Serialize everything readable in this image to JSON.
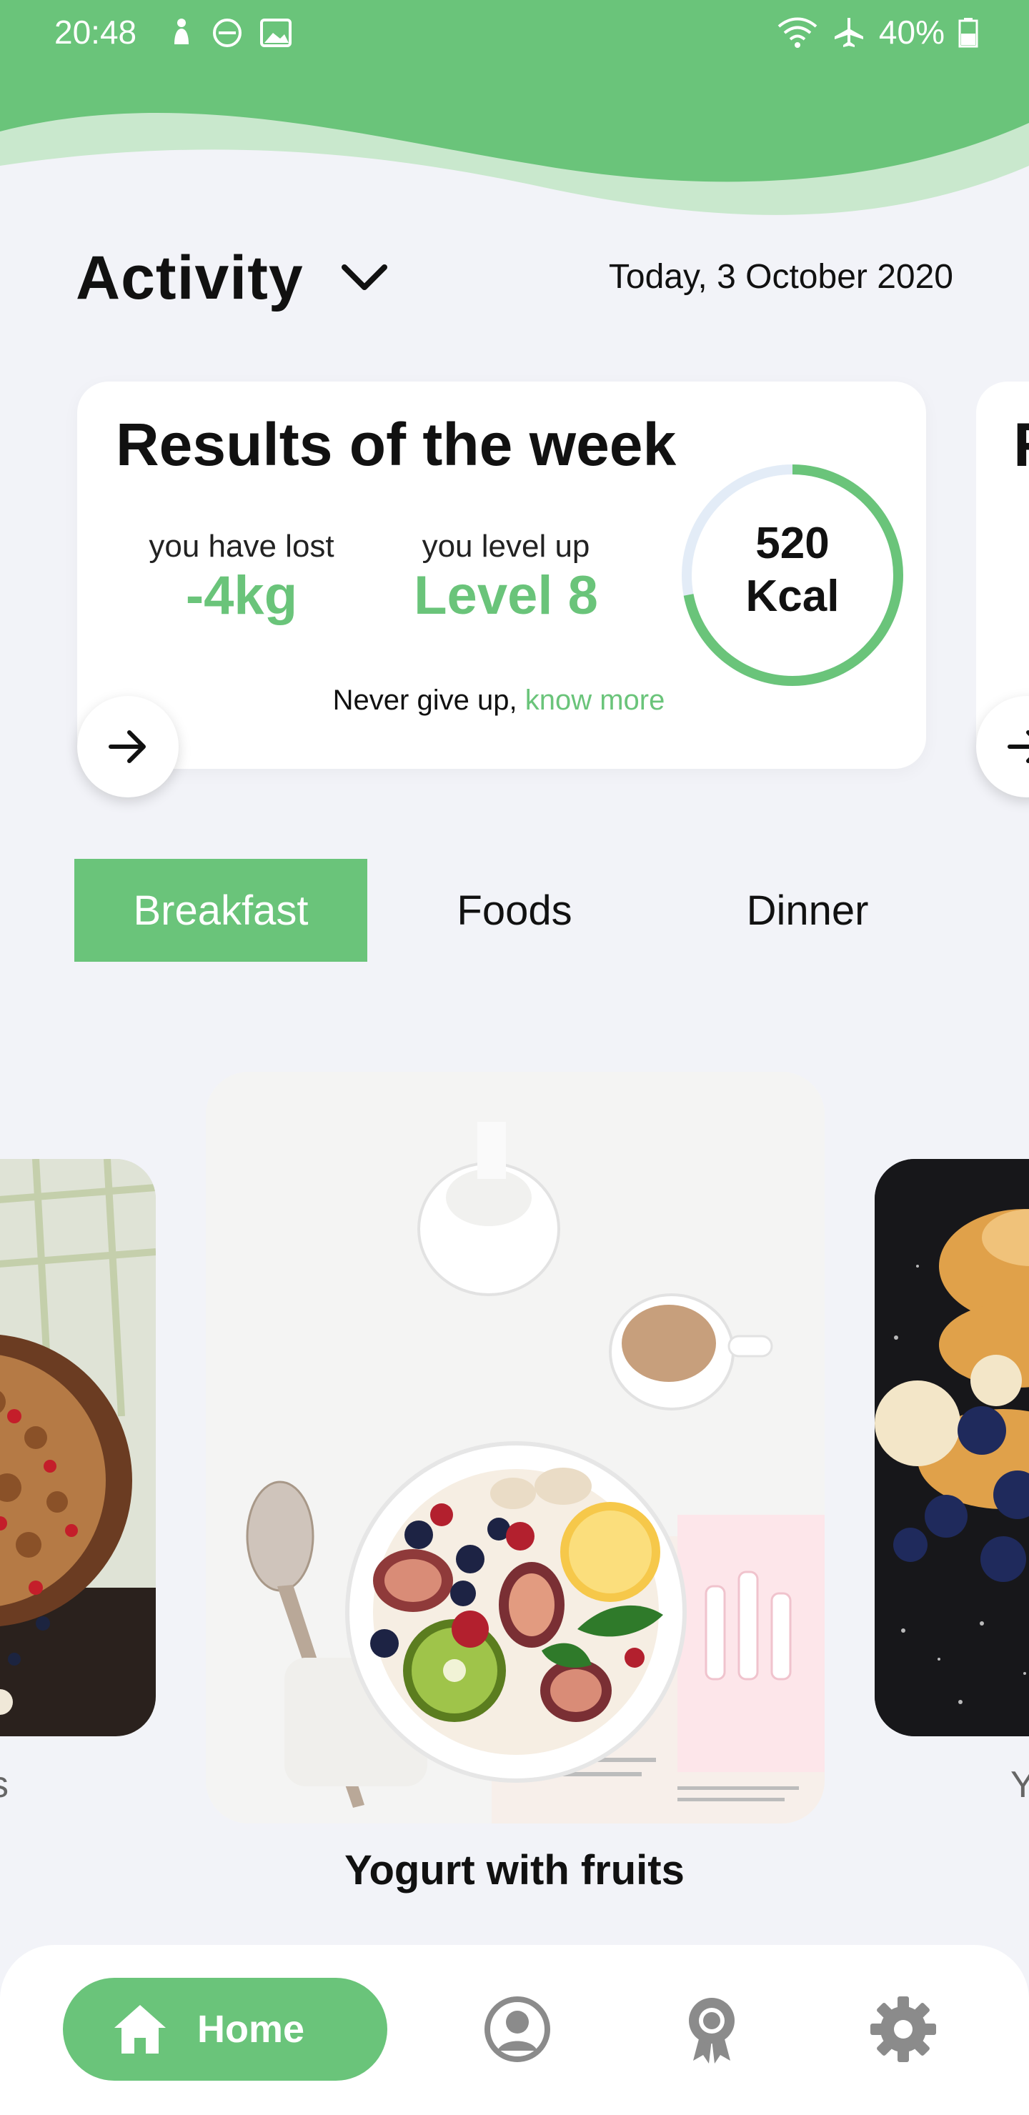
{
  "status_bar": {
    "time": "20:48",
    "battery": "40%",
    "icons_left": [
      "notification-icon",
      "do-not-disturb-icon",
      "image-icon"
    ],
    "icons_right": [
      "wifi-icon",
      "airplane-icon",
      "battery-icon"
    ]
  },
  "header": {
    "title": "Activity",
    "date": "Today, 3 October 2020"
  },
  "results_card": {
    "title": "Results of the week",
    "lost_caption": "you have lost",
    "lost_value": "-4kg",
    "level_caption": "you level up",
    "level_value": "Level 8",
    "kcal_value": "520",
    "kcal_unit": "Kcal",
    "kcal_progress": 0.72,
    "note_prefix": "Never give up, ",
    "note_link": "know more"
  },
  "next_card_peek": {
    "title_letter": "R"
  },
  "tabs": [
    {
      "label": "Breakfast",
      "active": true
    },
    {
      "label": "Foods",
      "active": false
    },
    {
      "label": "Dinner",
      "active": false
    }
  ],
  "foods": {
    "current_name": "Yogurt with fruits",
    "left_partial": "s",
    "right_partial": "Y"
  },
  "bottom_nav": {
    "home_label": "Home",
    "items": [
      "home-icon",
      "profile-icon",
      "award-icon",
      "settings-icon"
    ]
  },
  "colors": {
    "accent": "#6ac47a",
    "background": "#f2f3f8",
    "ring_track": "#e3ecf7"
  }
}
